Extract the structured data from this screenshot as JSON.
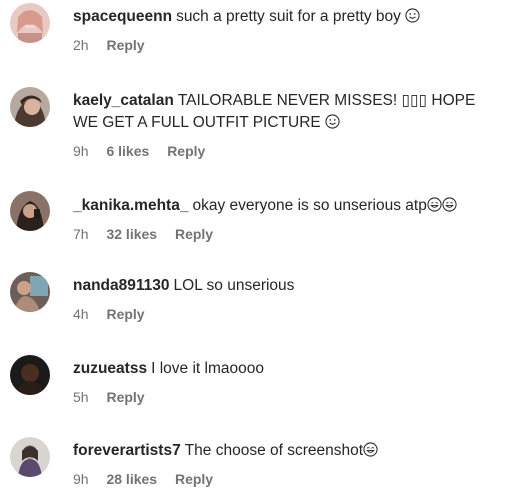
{
  "comments": [
    {
      "username": "spacequeenn",
      "text": "such a pretty suit for a pretty boy",
      "time": "2h",
      "likes": "",
      "reply": "Reply"
    },
    {
      "username": "kaely_catalan",
      "text": "TAILORABLE NEVER MISSES! ▯▯▯ HOPE WE GET A FULL OUTFIT PICTURE",
      "time": "9h",
      "likes": "6 likes",
      "reply": "Reply"
    },
    {
      "username": "_kanika.mehta_",
      "text": "okay everyone is so unserious atp",
      "time": "7h",
      "likes": "32 likes",
      "reply": "Reply"
    },
    {
      "username": "nanda891130",
      "text": "LOL so unserious",
      "time": "4h",
      "likes": "",
      "reply": "Reply"
    },
    {
      "username": "zuzueatss",
      "text": "I love it lmaoooo",
      "time": "5h",
      "likes": "",
      "reply": "Reply"
    },
    {
      "username": "foreverartists7",
      "text": "The choose of screenshot",
      "time": "9h",
      "likes": "28 likes",
      "reply": "Reply"
    }
  ],
  "icons": {
    "smile": "slightly-smiling-face-icon",
    "sweat": "grinning-sweat-face-icon",
    "laugh": "laughing-face-icon"
  }
}
